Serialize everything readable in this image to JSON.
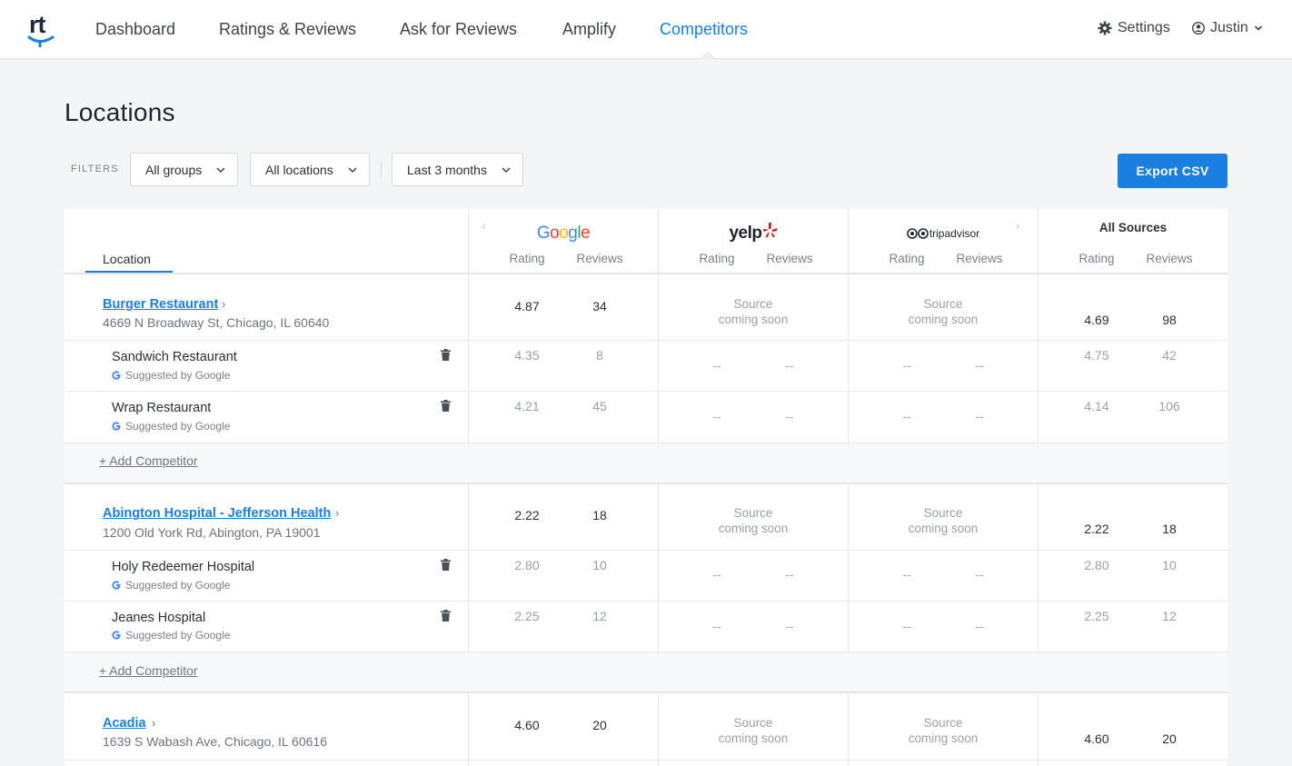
{
  "app": {
    "logo_text": "rt"
  },
  "nav": {
    "items": [
      "Dashboard",
      "Ratings & Reviews",
      "Ask for Reviews",
      "Amplify",
      "Competitors"
    ],
    "active": "Competitors",
    "settings_label": "Settings",
    "user_label": "Justin"
  },
  "page": {
    "title": "Locations",
    "filters_label": "FILTERS",
    "filters": [
      "All groups",
      "All locations",
      "Last 3 months"
    ],
    "export_label": "Export CSV"
  },
  "table": {
    "location_header": "Location",
    "sources": [
      "Google",
      "yelp",
      "tripadvisor"
    ],
    "all_sources_label": "All Sources",
    "rating_label": "Rating",
    "reviews_label": "Reviews",
    "coming_soon_line1": "Source",
    "coming_soon_line2": "coming soon",
    "empty": "--",
    "suggested_label": "Suggested by Google",
    "add_competitor_label": "+ Add Competitor",
    "groups": [
      {
        "name": "Burger Restaurant",
        "address": "4669 N Broadway St, Chicago, IL 60640",
        "google_rating": "4.87",
        "google_reviews": "34",
        "all_rating": "4.69",
        "all_reviews": "98",
        "competitors": [
          {
            "name": "Sandwich Restaurant",
            "google_rating": "4.35",
            "google_reviews": "8",
            "all_rating": "4.75",
            "all_reviews": "42"
          },
          {
            "name": "Wrap Restaurant",
            "google_rating": "4.21",
            "google_reviews": "45",
            "all_rating": "4.14",
            "all_reviews": "106"
          }
        ]
      },
      {
        "name": "Abington Hospital - Jefferson Health",
        "address": "1200 Old York Rd, Abington, PA 19001",
        "google_rating": "2.22",
        "google_reviews": "18",
        "all_rating": "2.22",
        "all_reviews": "18",
        "competitors": [
          {
            "name": "Holy Redeemer Hospital",
            "google_rating": "2.80",
            "google_reviews": "10",
            "all_rating": "2.80",
            "all_reviews": "10"
          },
          {
            "name": "Jeanes Hospital",
            "google_rating": "2.25",
            "google_reviews": "12",
            "all_rating": "2.25",
            "all_reviews": "12"
          }
        ]
      },
      {
        "name": "Acadia",
        "address": "1639 S Wabash Ave, Chicago, IL 60616",
        "google_rating": "4.60",
        "google_reviews": "20",
        "all_rating": "4.60",
        "all_reviews": "20",
        "competitors": []
      }
    ]
  },
  "colors": {
    "accent": "#1a7fe0",
    "background": "#f4f5f7"
  }
}
